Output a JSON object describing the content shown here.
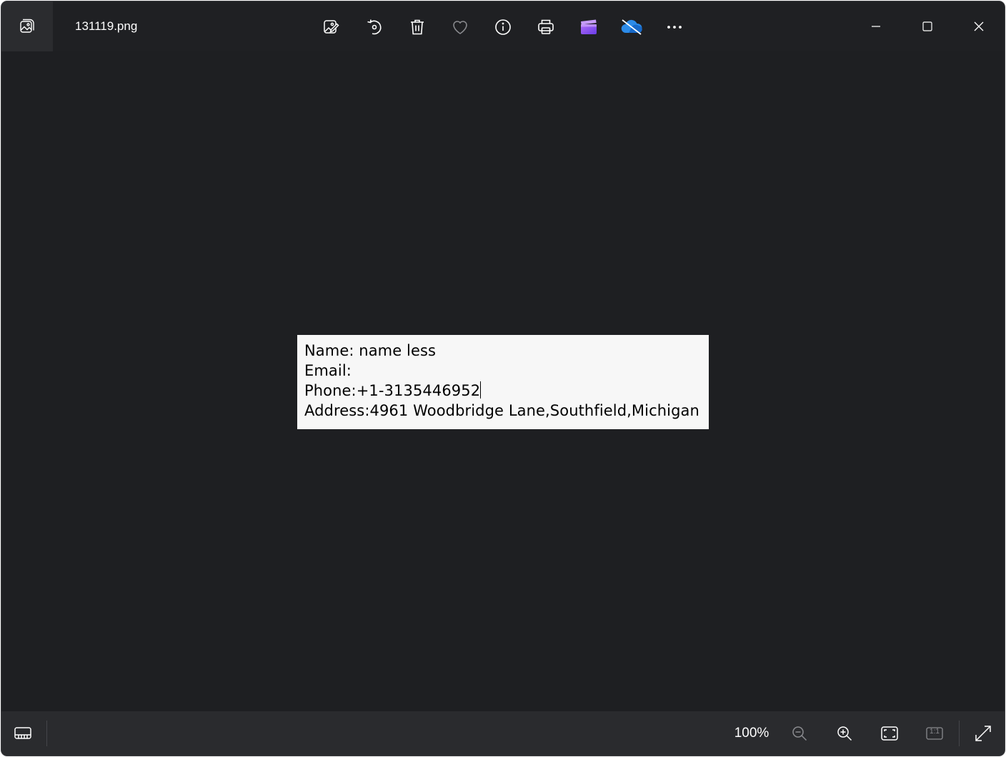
{
  "window": {
    "title": "131119.png"
  },
  "toolbar": {
    "items": [
      {
        "name": "edit-image-icon"
      },
      {
        "name": "rotate-icon"
      },
      {
        "name": "delete-icon"
      },
      {
        "name": "favorite-heart-icon"
      },
      {
        "name": "info-icon"
      },
      {
        "name": "print-icon"
      },
      {
        "name": "clipchamp-icon"
      },
      {
        "name": "onedrive-icon"
      },
      {
        "name": "more-options-icon"
      }
    ]
  },
  "image_content": {
    "lines": [
      "Name: name less",
      "Email:",
      "Phone:+1-3135446952",
      "Address:4961 Woodbridge Lane,Southfield,Michigan"
    ]
  },
  "statusbar": {
    "zoom_label": "100%",
    "actual_size_label": "1:1"
  },
  "colors": {
    "background": "#1e1f22",
    "toolbar": "#1f2023",
    "statusbar": "#2a2b2e",
    "clipchamp_accent": "#8b5cf6",
    "onedrive_accent": "#2c8be8"
  }
}
